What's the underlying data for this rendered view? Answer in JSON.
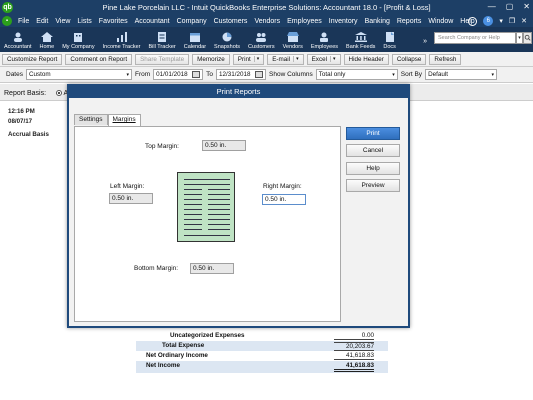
{
  "window": {
    "title": "Pine Lake Porcelain LLC  - Intuit QuickBooks Enterprise Solutions: Accountant 18.0 - [Profit & Loss]",
    "logo": "qb",
    "controls": [
      "—",
      "▢",
      "✕"
    ]
  },
  "menu": {
    "items": [
      "File",
      "Edit",
      "View",
      "Lists",
      "Favorites",
      "Accountant",
      "Company",
      "Customers",
      "Vendors",
      "Employees",
      "Inventory",
      "Banking",
      "Reports",
      "Window",
      "Help"
    ],
    "badge": "6"
  },
  "icons": [
    {
      "label": "Accountant",
      "icon": "accountant-icon"
    },
    {
      "label": "Home",
      "icon": "home-icon"
    },
    {
      "label": "My Company",
      "icon": "company-icon"
    },
    {
      "label": "Income Tracker",
      "icon": "income-tracker-icon"
    },
    {
      "label": "Bill Tracker",
      "icon": "bill-tracker-icon"
    },
    {
      "label": "Calendar",
      "icon": "calendar-icon"
    },
    {
      "label": "Snapshots",
      "icon": "snapshots-icon"
    },
    {
      "label": "Customers",
      "icon": "customers-icon"
    },
    {
      "label": "Vendors",
      "icon": "vendors-icon"
    },
    {
      "label": "Employees",
      "icon": "employees-icon"
    },
    {
      "label": "Bank Feeds",
      "icon": "bank-feeds-icon"
    },
    {
      "label": "Docs",
      "icon": "docs-icon"
    }
  ],
  "search": {
    "placeholder": "Search Company or Help"
  },
  "reportbar": {
    "customize": "Customize Report",
    "comment": "Comment on Report",
    "share": "Share Template",
    "memorize": "Memorize",
    "print": "Print",
    "email": "E-mail",
    "excel": "Excel",
    "hide_header": "Hide Header",
    "collapse": "Collapse",
    "refresh": "Refresh"
  },
  "filters": {
    "dates_label": "Dates",
    "dates_value": "Custom",
    "from_label": "From",
    "from_value": "01/01/2018",
    "to_label": "To",
    "to_value": "12/31/2018",
    "columns_label": "Show Columns",
    "columns_value": "Total only",
    "sort_label": "Sort By",
    "sort_value": "Default"
  },
  "basis": {
    "label": "Report Basis:",
    "option": "A"
  },
  "report_header": {
    "time": "12:16 PM",
    "date": "08/07/17",
    "basis": "Accrual Basis"
  },
  "report_rows": [
    {
      "label": "Uncategorized Expenses",
      "value": "0.00"
    },
    {
      "label": "Total Expense",
      "value": "20,203.67"
    },
    {
      "label": "Net Ordinary Income",
      "value": "41,618.83"
    },
    {
      "label": "Net Income",
      "value": "41,618.83"
    }
  ],
  "dialog": {
    "title": "Print Reports",
    "tab_settings": "Settings",
    "tab_margins": "Margins",
    "top_label": "Top Margin:",
    "top_value": "0.50 in.",
    "left_label": "Left Margin:",
    "left_value": "0.50 in.",
    "right_label": "Right Margin:",
    "right_value": "0.50 in.",
    "bottom_label": "Bottom Margin:",
    "bottom_value": "0.50 in.",
    "print": "Print",
    "cancel": "Cancel",
    "help": "Help",
    "preview": "Preview"
  }
}
